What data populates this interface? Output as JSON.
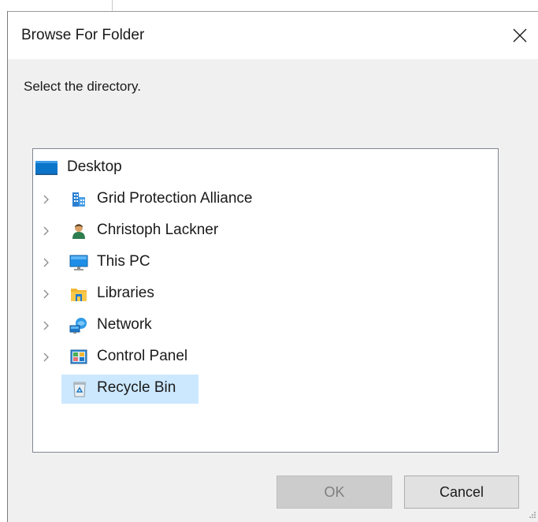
{
  "window": {
    "title": "Browse For Folder",
    "close_icon": "close-icon"
  },
  "instruction": "Select the directory.",
  "tree": {
    "root": {
      "label": "Desktop",
      "icon": "desktop-icon"
    },
    "items": [
      {
        "label": "Grid Protection Alliance",
        "icon": "building-icon",
        "expandable": true
      },
      {
        "label": "Christoph Lackner",
        "icon": "user-icon",
        "expandable": true
      },
      {
        "label": "This PC",
        "icon": "computer-icon",
        "expandable": true
      },
      {
        "label": "Libraries",
        "icon": "libraries-icon",
        "expandable": true
      },
      {
        "label": "Network",
        "icon": "network-icon",
        "expandable": true
      },
      {
        "label": "Control Panel",
        "icon": "control-panel-icon",
        "expandable": true
      },
      {
        "label": "Recycle Bin",
        "icon": "recycle-bin-icon",
        "expandable": false,
        "selected": true
      }
    ]
  },
  "buttons": {
    "ok": "OK",
    "cancel": "Cancel"
  },
  "colors": {
    "selection": "#cce8ff",
    "dialog_bg": "#f0f0f0",
    "disabled_button": "#cccccc"
  }
}
